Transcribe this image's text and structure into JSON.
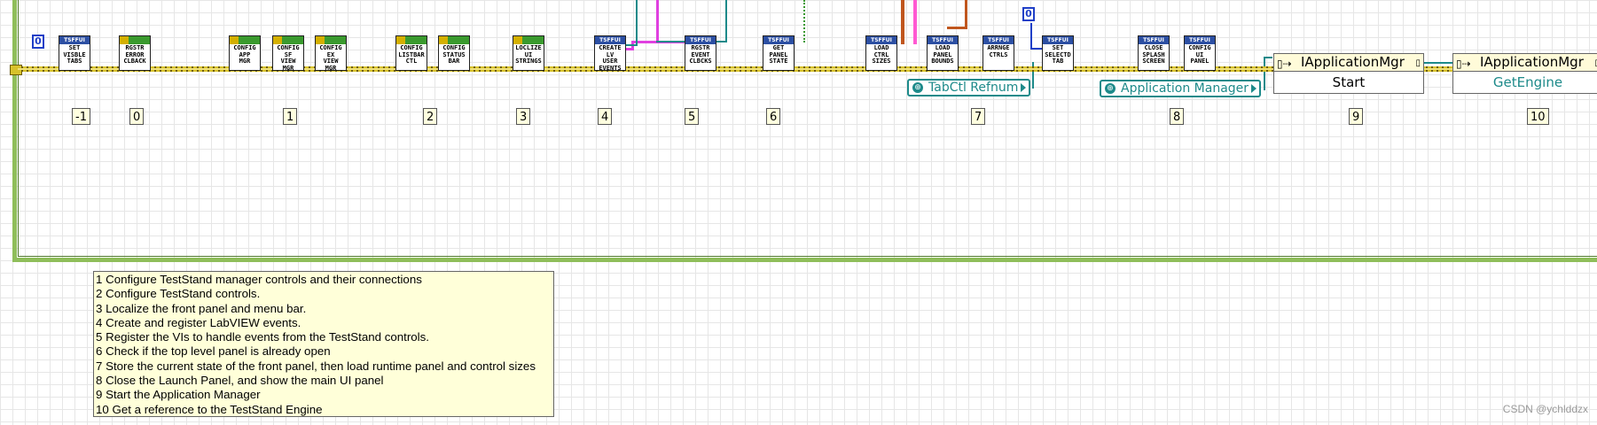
{
  "subvis": [
    {
      "label": "SET VISBLE TABS",
      "header": "TSFFUI"
    },
    {
      "label": "RGSTR ERROR CLBACK",
      "header": "OK"
    },
    {
      "label": "CONFIG APP MGR",
      "header": "OK"
    },
    {
      "label": "CONFIG SF VIEW MGR",
      "header": "OK"
    },
    {
      "label": "CONFIG EX VIEW MGR",
      "header": "OK"
    },
    {
      "label": "CONFIG LISTBAR CTL",
      "header": "OK"
    },
    {
      "label": "CONFIG STATUS BAR",
      "header": "OK"
    },
    {
      "label": "LOCLIZE UI STRINGS",
      "header": "OK"
    },
    {
      "label": "CREATE LV USER EVENTS",
      "header": "TSFFUI"
    },
    {
      "label": "RGSTR EVENT CLBCKS",
      "header": "TSFFUI"
    },
    {
      "label": "GET PANEL STATE",
      "header": "TSFFUI"
    },
    {
      "label": "LOAD CTRL SIZES",
      "header": "TSFFUI"
    },
    {
      "label": "LOAD PANEL BOUNDS",
      "header": "TSFFUI"
    },
    {
      "label": "ARRNGE CTRLS",
      "header": "TSFFUI"
    },
    {
      "label": "SET SELECTD TAB",
      "header": "TSFFUI"
    },
    {
      "label": "CLOSE SPLASH SCREEN",
      "header": "TSFFUI"
    },
    {
      "label": "CONFIG UI PANEL",
      "header": "TSFFUI"
    }
  ],
  "constants": [
    "0",
    "0"
  ],
  "step_labels": [
    "-1",
    "0",
    "1",
    "2",
    "3",
    "4",
    "5",
    "6",
    "7",
    "8",
    "9",
    "10"
  ],
  "refnums": [
    "TabCtl Refnum",
    "Application Manager"
  ],
  "invoke_nodes": [
    {
      "class": "IApplicationMgr",
      "method": "Start"
    },
    {
      "class": "IApplicationMgr",
      "method": "GetEngine"
    }
  ],
  "note_lines": [
    "1 Configure TestStand manager controls and their connections",
    "2 Configure TestStand controls.",
    "3 Localize the front panel and menu bar.",
    "4 Create and register LabVIEW events.",
    "5 Register the VIs to handle events from the TestStand controls.",
    "6 Check if the top level panel is already open",
    "7 Store the current state of the front panel, then load runtime panel and control sizes",
    "8 Close the Launch Panel, and show the main UI panel",
    "9 Start the Application Manager",
    "10 Get a reference to the TestStand Engine"
  ],
  "watermark": "CSDN @ychlddzx",
  "colors": {
    "error_wire": "#d8c22a",
    "frame": "#8fbe5a",
    "refnum": "#1d8a8a",
    "constant": "#1f3fc7"
  }
}
